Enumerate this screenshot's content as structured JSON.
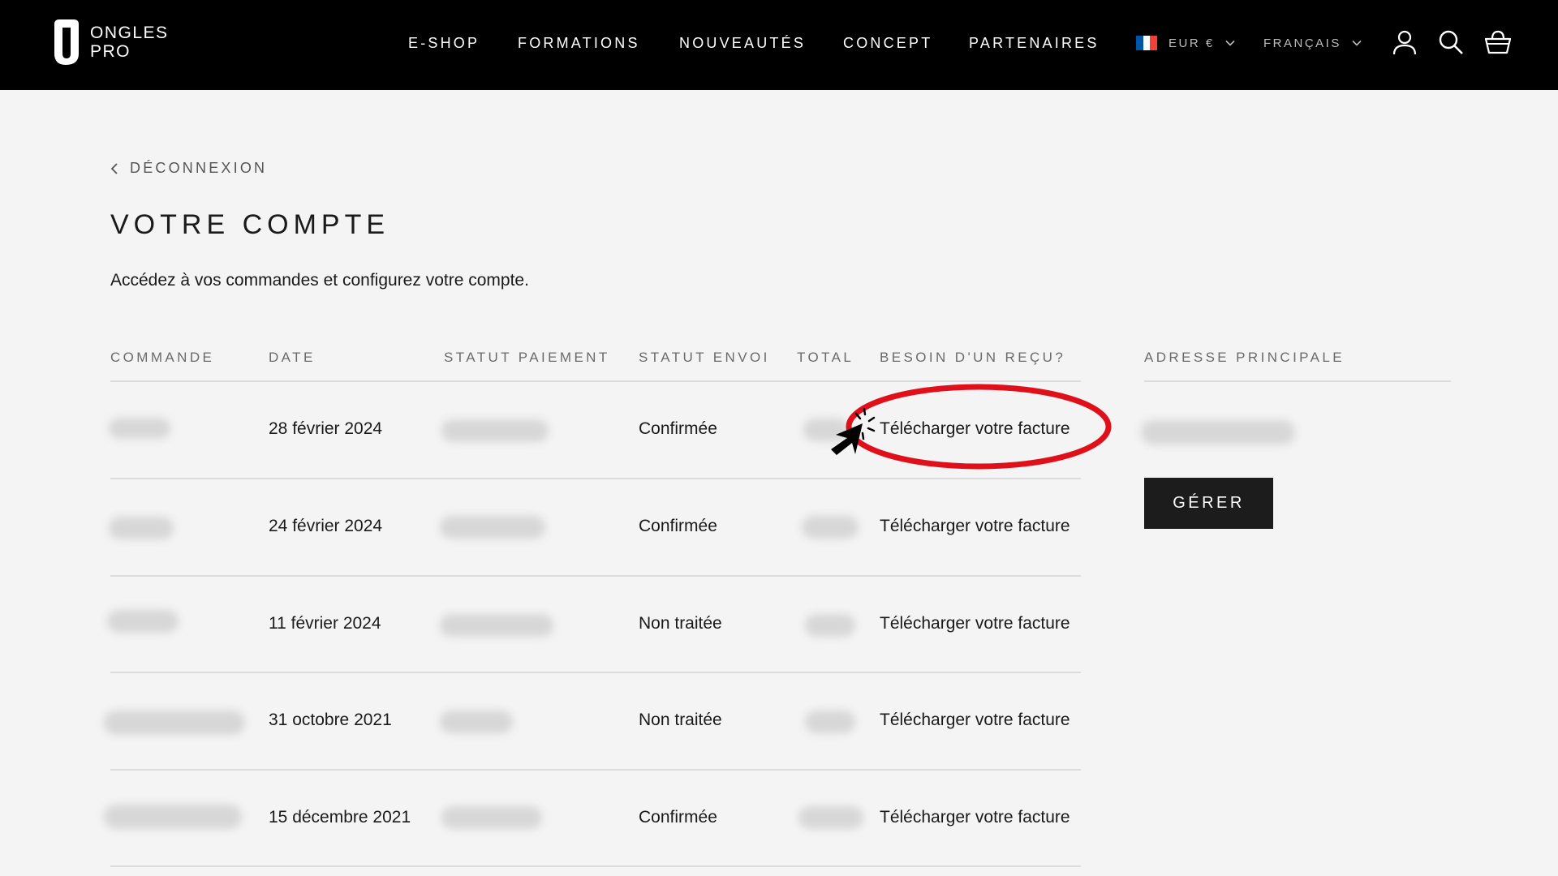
{
  "brand": {
    "line1": "ONGLES",
    "line2": "PRO"
  },
  "nav": [
    "E-SHOP",
    "FORMATIONS",
    "NOUVEAUTÉS",
    "CONCEPT",
    "PARTENAIRES"
  ],
  "currency": {
    "label": "EUR €",
    "flag_colors": [
      "#0055a4",
      "#ffffff",
      "#ef4135"
    ]
  },
  "language": {
    "label": "FRANÇAIS"
  },
  "icons": {
    "account": "user-icon",
    "search": "search-icon",
    "cart": "basket-icon"
  },
  "back_link": "DÉCONNEXION",
  "page_title": "VOTRE COMPTE",
  "subtitle": "Accédez à vos commandes et configurez votre compte.",
  "orders": {
    "columns": [
      "COMMANDE",
      "DATE",
      "STATUT PAIEMENT",
      "STATUT ENVOI",
      "TOTAL",
      "BESOIN D'UN REÇU?"
    ],
    "rows": [
      {
        "date": "28 février 2024",
        "shipping": "Confirmée",
        "receipt": "Télécharger votre facture"
      },
      {
        "date": "24 février 2024",
        "shipping": "Confirmée",
        "receipt": "Télécharger votre facture"
      },
      {
        "date": "11 février 2024",
        "shipping": "Non traitée",
        "receipt": "Télécharger votre facture"
      },
      {
        "date": "31 octobre 2021",
        "shipping": "Non traitée",
        "receipt": "Télécharger votre facture"
      },
      {
        "date": "15 décembre 2021",
        "shipping": "Confirmée",
        "receipt": "Télécharger votre facture"
      }
    ]
  },
  "address": {
    "heading": "ADRESSE PRINCIPALE",
    "manage_label": "GÉRER"
  },
  "colors": {
    "header_bg": "#000000",
    "page_bg": "#f4f4f4",
    "annotation": "#e0101a",
    "button_bg": "#1c1c1c"
  }
}
